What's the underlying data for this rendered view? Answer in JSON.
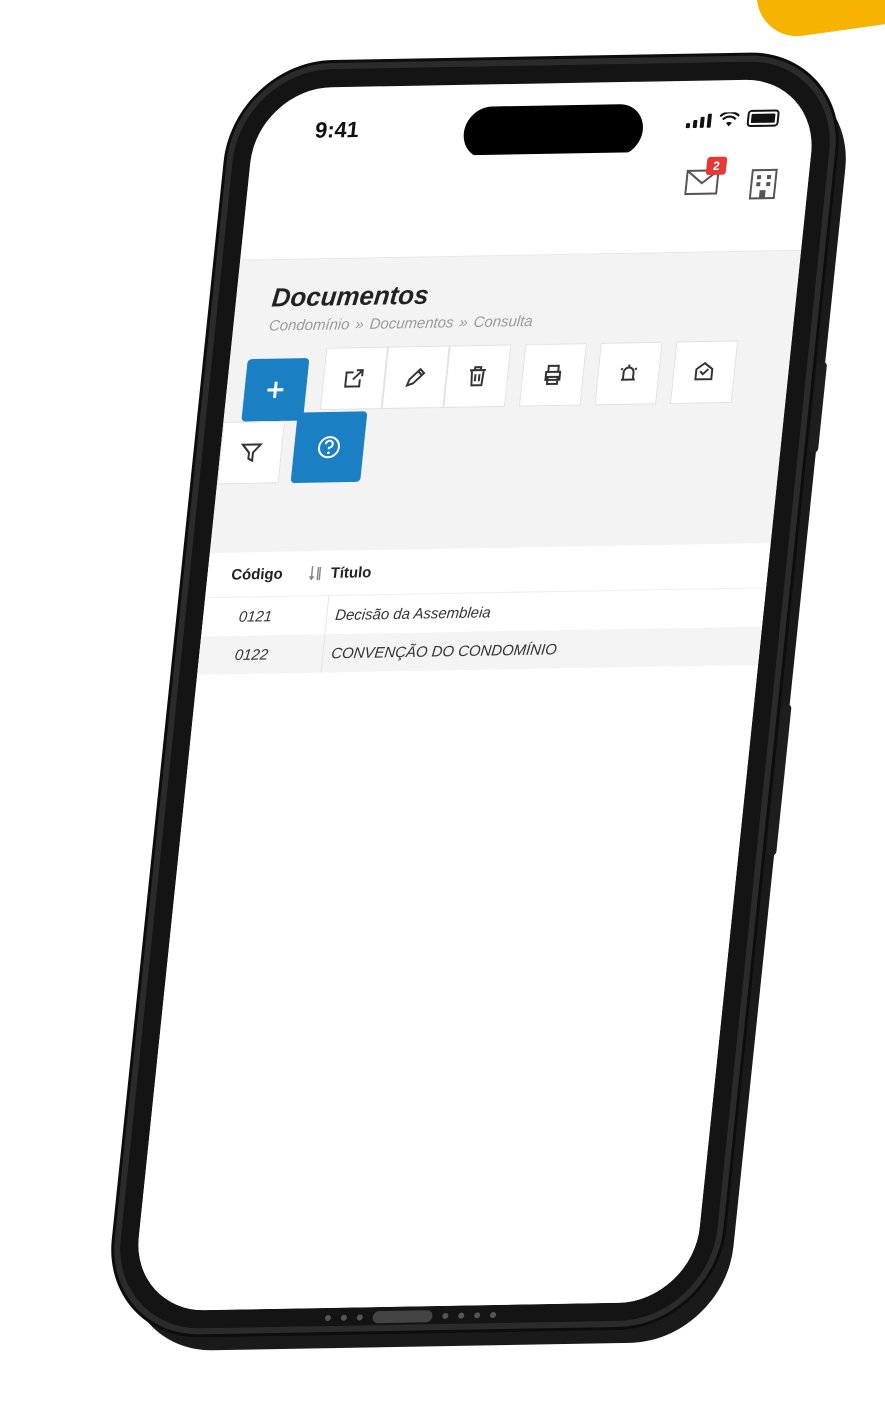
{
  "status_bar": {
    "time": "9:41"
  },
  "header": {
    "mail_badge": "2"
  },
  "page": {
    "title": "Documentos",
    "breadcrumb": [
      "Condomínio",
      "Documentos",
      "Consulta"
    ],
    "breadcrumb_separator": "»"
  },
  "toolbar": {
    "buttons": [
      {
        "name": "add",
        "icon": "plus-icon"
      },
      {
        "name": "open",
        "icon": "external-link-icon"
      },
      {
        "name": "edit",
        "icon": "pencil-icon"
      },
      {
        "name": "delete",
        "icon": "trash-icon"
      },
      {
        "name": "print",
        "icon": "printer-icon"
      },
      {
        "name": "alarm",
        "icon": "alarm-icon"
      },
      {
        "name": "send",
        "icon": "mail-check-icon"
      },
      {
        "name": "filter",
        "icon": "filter-icon"
      },
      {
        "name": "help",
        "icon": "help-icon"
      }
    ]
  },
  "table": {
    "columns": [
      "Código",
      "Título"
    ],
    "rows": [
      {
        "code": "0121",
        "title": "Decisão da Assembleia"
      },
      {
        "code": "0122",
        "title": "CONVENÇÃO DO CONDOMÍNIO"
      }
    ]
  },
  "colors": {
    "accent": "#1b7fc4",
    "badge": "#e53935",
    "corner": "#f6b400"
  }
}
